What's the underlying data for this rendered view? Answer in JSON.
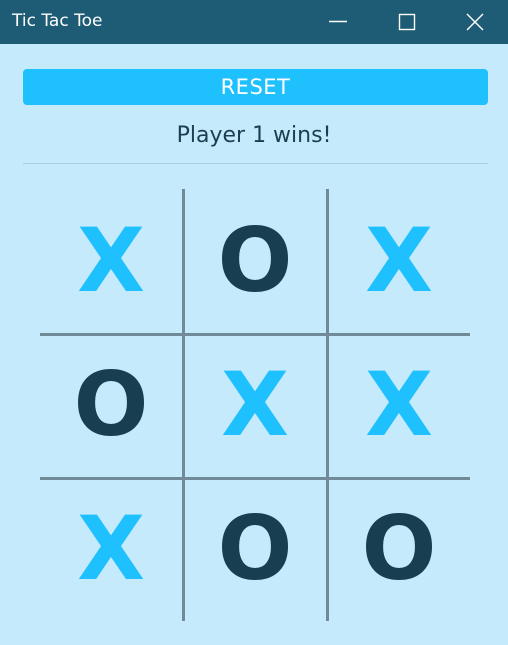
{
  "window": {
    "title": "Tic Tac Toe"
  },
  "controls": {
    "reset_label": "RESET"
  },
  "status": {
    "message": "Player 1 wins!"
  },
  "board": {
    "cells": [
      {
        "row": 1,
        "col": 1,
        "mark": "X"
      },
      {
        "row": 1,
        "col": 2,
        "mark": "O"
      },
      {
        "row": 1,
        "col": 3,
        "mark": "X"
      },
      {
        "row": 2,
        "col": 1,
        "mark": "O"
      },
      {
        "row": 2,
        "col": 2,
        "mark": "X"
      },
      {
        "row": 2,
        "col": 3,
        "mark": "X"
      },
      {
        "row": 3,
        "col": 1,
        "mark": "X"
      },
      {
        "row": 3,
        "col": 2,
        "mark": "O"
      },
      {
        "row": 3,
        "col": 3,
        "mark": "O"
      }
    ]
  },
  "colors": {
    "titlebar": "#1e5b74",
    "background": "#c5eafc",
    "accent": "#1ec0fd",
    "mark_x": "#1ec0fd",
    "mark_o": "#183f51",
    "grid": "#708a98"
  },
  "icons": {
    "minimize": "minimize-icon",
    "maximize": "maximize-icon",
    "close": "close-icon"
  }
}
